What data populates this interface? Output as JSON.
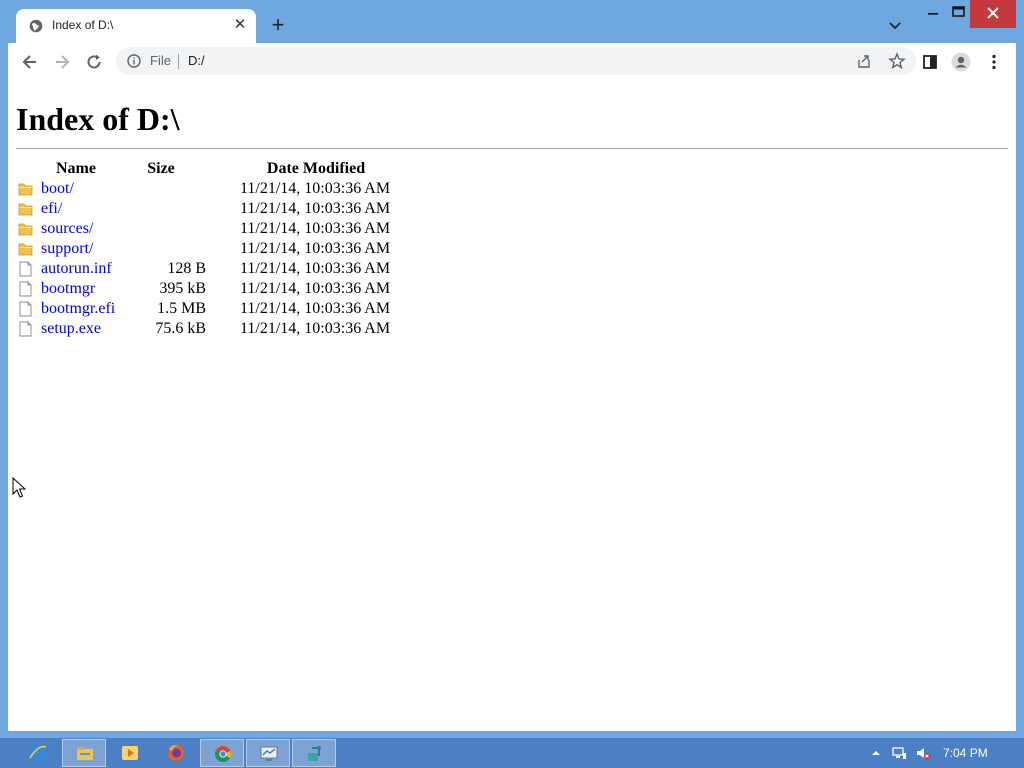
{
  "browser": {
    "tab_title": "Index of D:\\",
    "new_tab_label": "+",
    "scheme_label": "File",
    "url": "D:/"
  },
  "page": {
    "heading": "Index of D:\\",
    "columns": {
      "name": "Name",
      "size": "Size",
      "date": "Date Modified"
    },
    "entries": [
      {
        "name": "boot/",
        "size": "",
        "date": "11/21/14, 10:03:36 AM",
        "kind": "folder"
      },
      {
        "name": "efi/",
        "size": "",
        "date": "11/21/14, 10:03:36 AM",
        "kind": "folder"
      },
      {
        "name": "sources/",
        "size": "",
        "date": "11/21/14, 10:03:36 AM",
        "kind": "folder"
      },
      {
        "name": "support/",
        "size": "",
        "date": "11/21/14, 10:03:36 AM",
        "kind": "folder"
      },
      {
        "name": "autorun.inf",
        "size": "128 B",
        "date": "11/21/14, 10:03:36 AM",
        "kind": "file"
      },
      {
        "name": "bootmgr",
        "size": "395 kB",
        "date": "11/21/14, 10:03:36 AM",
        "kind": "file"
      },
      {
        "name": "bootmgr.efi",
        "size": "1.5 MB",
        "date": "11/21/14, 10:03:36 AM",
        "kind": "file"
      },
      {
        "name": "setup.exe",
        "size": "75.6 kB",
        "date": "11/21/14, 10:03:36 AM",
        "kind": "file"
      }
    ]
  },
  "taskbar": {
    "apps": [
      "internet-explorer-icon",
      "file-explorer-icon",
      "media-player-icon",
      "firefox-icon",
      "chrome-icon",
      "network-monitor-icon",
      "remote-app-icon"
    ],
    "clock": "7:04 PM"
  },
  "colors": {
    "title_bar": "#6fa8e0",
    "taskbar": "#4b80c4",
    "link": "#0000ee",
    "folder": "#f2c14e"
  }
}
